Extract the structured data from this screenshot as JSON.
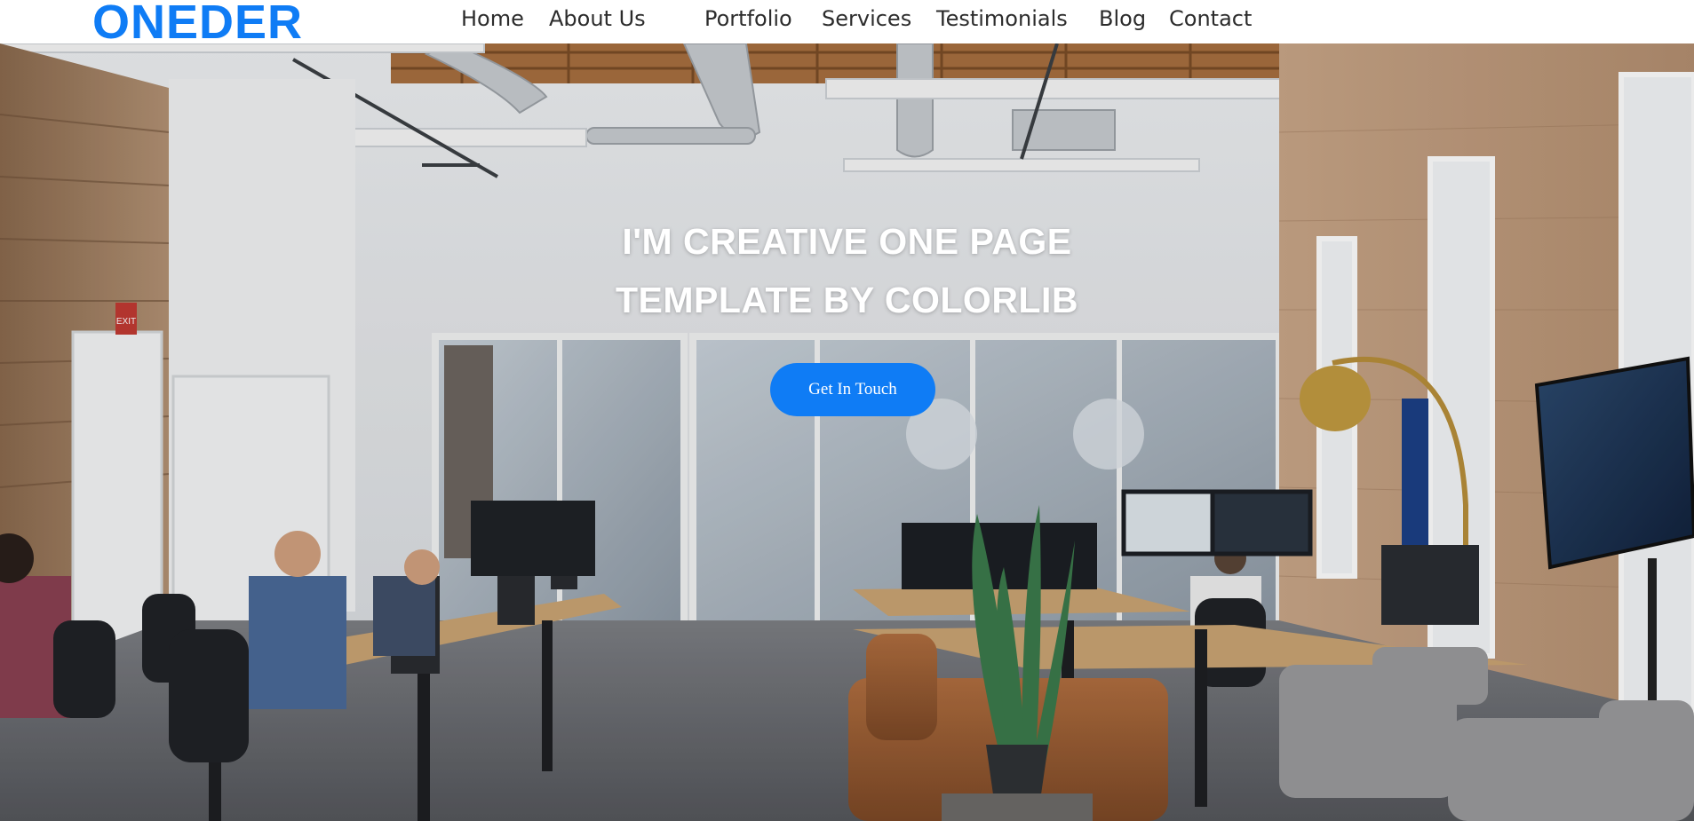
{
  "brand": {
    "logo_text": "ONEDER",
    "accent_color": "#0f7cf5"
  },
  "nav": {
    "items": [
      {
        "label": "Home"
      },
      {
        "label": "About Us"
      },
      {
        "label": "Portfolio"
      },
      {
        "label": "Services"
      },
      {
        "label": "Testimonials"
      },
      {
        "label": "Blog"
      },
      {
        "label": "Contact"
      }
    ]
  },
  "hero": {
    "title_line_1": "I'M CREATIVE ONE PAGE",
    "title_line_2": "TEMPLATE BY COLORLIB",
    "cta_label": "Get In Touch",
    "exit_sign_text": "EXIT"
  }
}
